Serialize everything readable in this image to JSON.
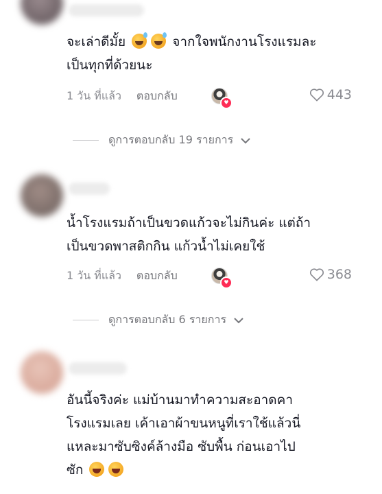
{
  "comments": [
    {
      "username": "username",
      "lines": [
        "จะเล่าดีมั้ย",
        "จากใจพนักงานโรงแรมละ",
        "เป็นทุกที่ด้วยนะ"
      ],
      "time": "1 วัน ที่แล้ว",
      "reply": "ตอบกลับ",
      "likes": "443",
      "view_replies": "ดูการตอบกลับ 19 รายการ"
    },
    {
      "username": "name",
      "lines": [
        "น้ำโรงแรมถ้าเป็นขวดแก้วจะไม่กินค่ะ แต่ถ้า",
        "เป็นขวดพาสติกกิน แก้วน้ำไม่เคยใช้"
      ],
      "time": "1 วัน ที่แล้ว",
      "reply": "ตอบกลับ",
      "likes": "368",
      "view_replies": "ดูการตอบกลับ 6 รายการ"
    },
    {
      "username": "username",
      "lines": [
        "อันนี้จริงค่ะ แม่บ้านมาทำความสะอาดคา",
        "โรงแรมเลย เค้าเอาผ้าขนหนูที่เราใช้แล้วนี่",
        "แหละมาซับซิงค์ล้างมือ ซับพื้น ก่อนเอาไป",
        "ซัก"
      ]
    }
  ],
  "icons": {
    "like": "heart-outline-icon",
    "expand": "chevron-down-icon",
    "creator_liked": "creator-liked-badge"
  },
  "colors": {
    "text": "#161823",
    "muted": "#8a8b91",
    "badge": "#fe2c55"
  }
}
